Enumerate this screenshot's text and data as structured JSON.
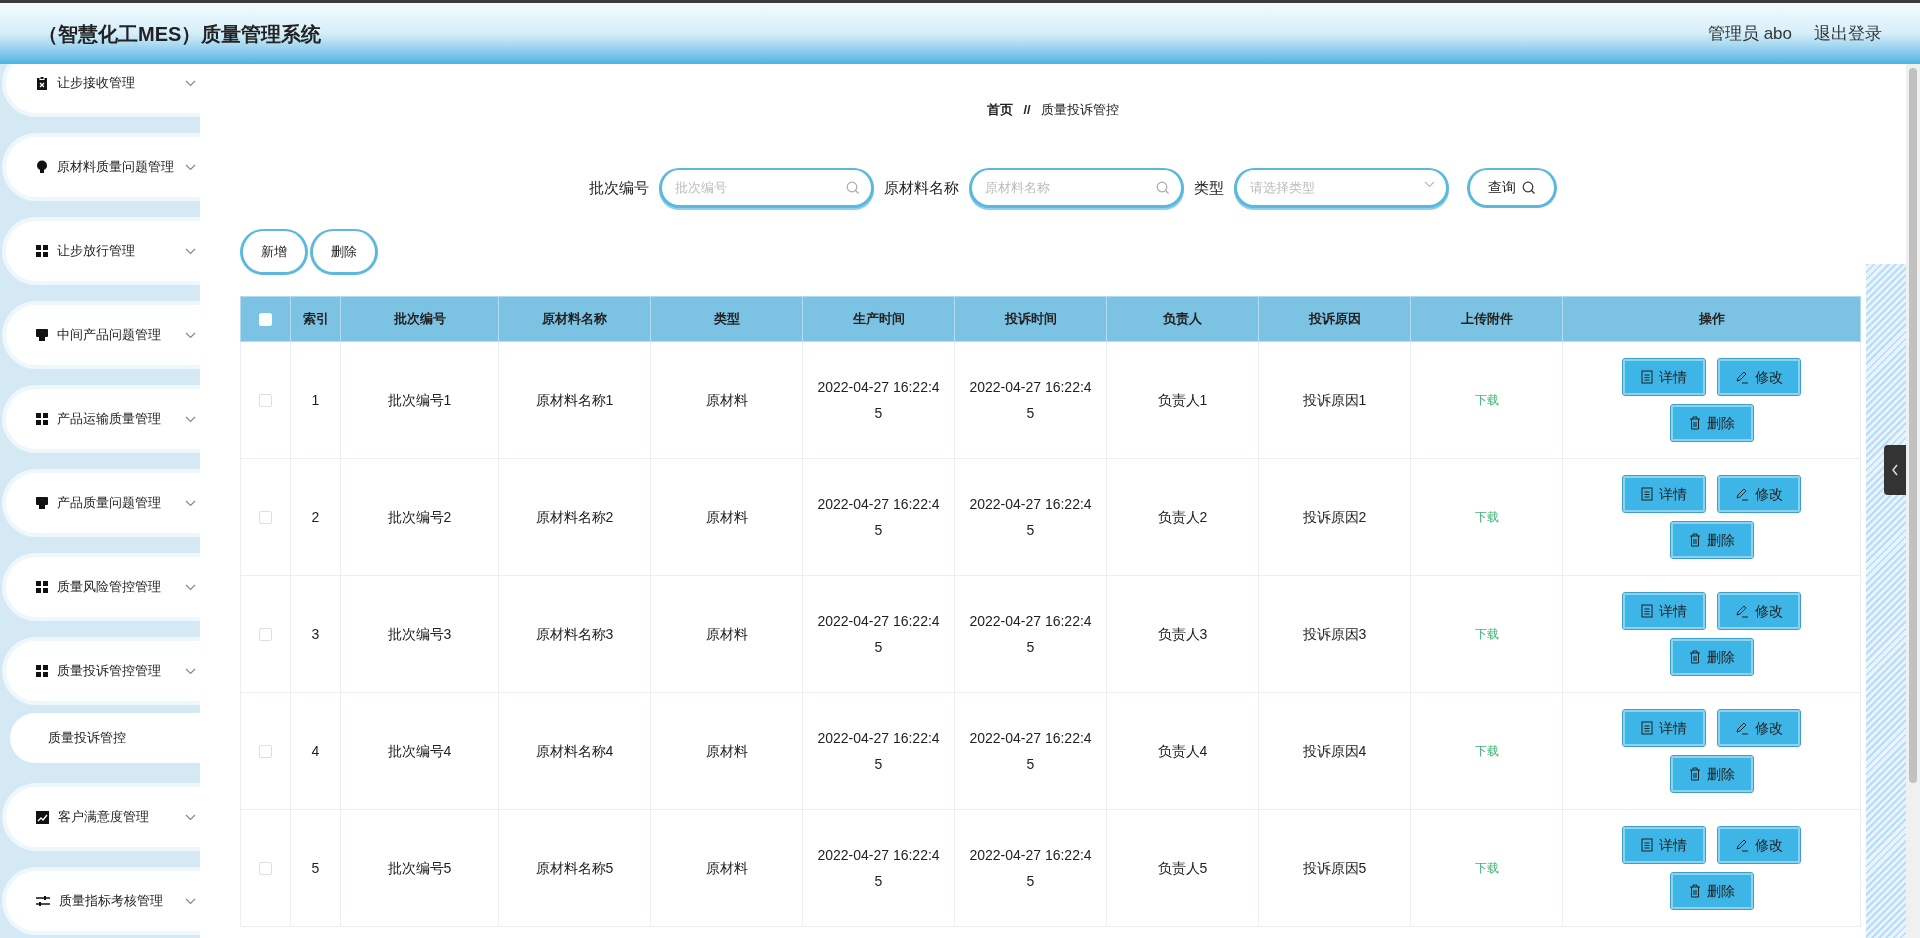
{
  "header": {
    "title": "（智慧化工MES）质量管理系统",
    "user": "管理员 abo",
    "logout": "退出登录"
  },
  "sidebar": {
    "items": [
      {
        "label": "让步接收管理"
      },
      {
        "label": "原材料质量问题管理"
      },
      {
        "label": "让步放行管理"
      },
      {
        "label": "中间产品问题管理"
      },
      {
        "label": "产品运输质量管理"
      },
      {
        "label": "产品质量问题管理"
      },
      {
        "label": "质量风险管控管理"
      },
      {
        "label": "质量投诉管控管理",
        "children": [
          {
            "label": "质量投诉管控"
          }
        ]
      },
      {
        "label": "客户满意度管理"
      },
      {
        "label": "质量指标考核管理"
      }
    ]
  },
  "breadcrumb": {
    "home": "首页",
    "separator": "//",
    "current": "质量投诉管控"
  },
  "search": {
    "fields": [
      {
        "kind": "text",
        "label": "批次编号",
        "placeholder": "批次编号"
      },
      {
        "kind": "text",
        "label": "原材料名称",
        "placeholder": "原材料名称"
      },
      {
        "kind": "select",
        "label": "类型",
        "placeholder": "请选择类型"
      }
    ],
    "button": "查询"
  },
  "actions": [
    "新增",
    "删除"
  ],
  "table": {
    "select_all": {
      "checked": false
    },
    "columns": [
      "索引",
      "批次编号",
      "原材料名称",
      "类型",
      "生产时间",
      "投诉时间",
      "负责人",
      "投诉原因",
      "上传附件",
      "操作"
    ],
    "rows": [
      {
        "checked": false,
        "cells": [
          "1",
          "批次编号1",
          "原材料名称1",
          "原材料",
          "2022-04-27 16:22:45",
          "2022-04-27 16:22:45",
          "负责人1",
          "投诉原因1"
        ],
        "download": "下载",
        "buttons": [
          "详情",
          "修改",
          "删除"
        ]
      },
      {
        "checked": false,
        "cells": [
          "2",
          "批次编号2",
          "原材料名称2",
          "原材料",
          "2022-04-27 16:22:45",
          "2022-04-27 16:22:45",
          "负责人2",
          "投诉原因2"
        ],
        "download": "下载",
        "buttons": [
          "详情",
          "修改",
          "删除"
        ]
      },
      {
        "checked": false,
        "cells": [
          "3",
          "批次编号3",
          "原材料名称3",
          "原材料",
          "2022-04-27 16:22:45",
          "2022-04-27 16:22:45",
          "负责人3",
          "投诉原因3"
        ],
        "download": "下载",
        "buttons": [
          "详情",
          "修改",
          "删除"
        ]
      },
      {
        "checked": false,
        "cells": [
          "4",
          "批次编号4",
          "原材料名称4",
          "原材料",
          "2022-04-27 16:22:45",
          "2022-04-27 16:22:45",
          "负责人4",
          "投诉原因4"
        ],
        "download": "下载",
        "buttons": [
          "详情",
          "修改",
          "删除"
        ]
      },
      {
        "checked": false,
        "cells": [
          "5",
          "批次编号5",
          "原材料名称5",
          "原材料",
          "2022-04-27 16:22:45",
          "2022-04-27 16:22:45",
          "负责人5",
          "投诉原因5"
        ],
        "download": "下载",
        "buttons": [
          "详情",
          "修改",
          "删除"
        ]
      }
    ]
  }
}
